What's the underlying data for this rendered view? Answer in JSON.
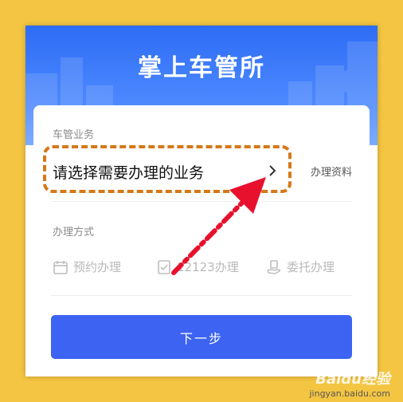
{
  "app": {
    "title": "掌上车管所"
  },
  "business": {
    "section_label": "车管业务",
    "select_prompt": "请选择需要办理的业务",
    "resources_link": "办理资料"
  },
  "method": {
    "section_label": "办理方式",
    "options": [
      {
        "label": "预约办理",
        "icon": "calendar-icon"
      },
      {
        "label": "12123办理",
        "icon": "phone-check-icon"
      },
      {
        "label": "委托办理",
        "icon": "hand-document-icon"
      }
    ]
  },
  "actions": {
    "next_label": "下一步"
  },
  "annotation": {
    "highlight_color": "#d67818",
    "arrow_color": "#e8112d"
  },
  "watermark": {
    "logo": "Baidu经验",
    "url": "jingyan.baidu.com"
  },
  "colors": {
    "brand_blue": "#3d63f2",
    "header_blue": "#2d6cf5",
    "background": "#f4c542"
  }
}
